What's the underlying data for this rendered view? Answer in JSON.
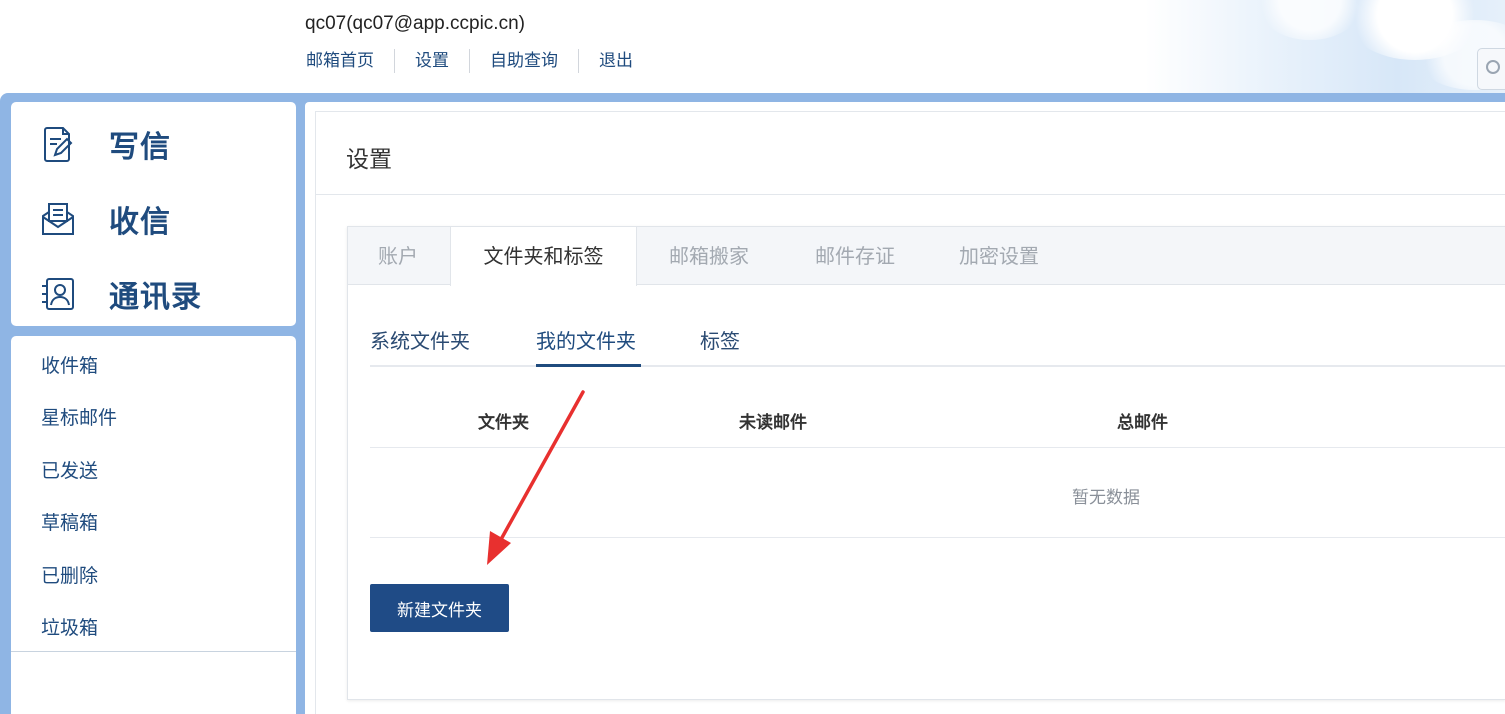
{
  "header": {
    "user": "qc07(qc07@app.ccpic.cn)",
    "nav": [
      "邮箱首页",
      "设置",
      "自助查询",
      "退出"
    ]
  },
  "sidebar": {
    "actions": [
      {
        "label": "写信",
        "icon": "compose-icon"
      },
      {
        "label": "收信",
        "icon": "inbox-envelope-icon"
      },
      {
        "label": "通讯录",
        "icon": "contacts-icon"
      }
    ],
    "folders": [
      "收件箱",
      "星标邮件",
      "已发送",
      "草稿箱",
      "已删除",
      "垃圾箱"
    ]
  },
  "settings": {
    "title": "设置",
    "tabs": [
      "账户",
      "文件夹和标签",
      "邮箱搬家",
      "邮件存证",
      "加密设置"
    ],
    "active_tab": "文件夹和标签",
    "subtabs": [
      "系统文件夹",
      "我的文件夹",
      "标签"
    ],
    "active_subtab": "我的文件夹",
    "table": {
      "columns": [
        "文件夹",
        "未读邮件",
        "总邮件"
      ],
      "empty_text": "暂无数据"
    },
    "new_folder_button": "新建文件夹"
  },
  "colors": {
    "brand_blue": "#1f4b7e",
    "frame_blue": "#8fb5e4",
    "button_blue": "#1f4b86",
    "annotation_red": "#e8302f"
  }
}
